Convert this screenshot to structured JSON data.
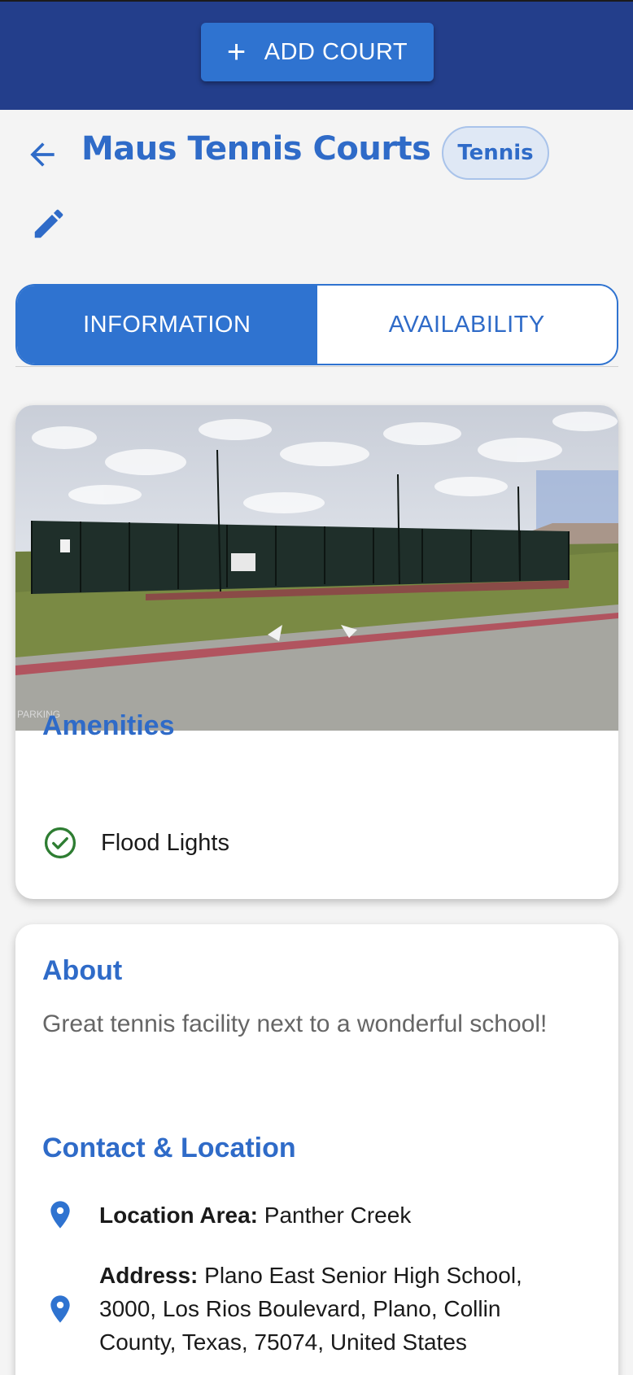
{
  "topbar": {
    "add_label": "ADD COURT",
    "color": "#233e8b"
  },
  "header": {
    "title": "Maus Tennis Courts",
    "sport_chip": "Tennis"
  },
  "tabs": [
    {
      "label": "INFORMATION",
      "active": true
    },
    {
      "label": "AVAILABILITY",
      "active": false
    }
  ],
  "amenities": {
    "heading": "Amenities",
    "items": [
      {
        "label": "Flood Lights",
        "icon": "check-circle-icon"
      }
    ]
  },
  "about": {
    "heading": "About",
    "text": "Great tennis facility next to a wonderful school!"
  },
  "contact": {
    "heading": "Contact & Location",
    "location_area_label": "Location Area:",
    "location_area_value": "Panther Creek",
    "address_label": "Address:",
    "address_value": "Plano East Senior High School, 3000, Los Rios Boulevard, Plano, Collin County, Texas, 75074, United States"
  },
  "photo": {
    "watermark": "PARKING"
  },
  "colors": {
    "accent": "#2f73d0",
    "title_blue": "#2f6bc8",
    "success": "#2e7d32"
  }
}
